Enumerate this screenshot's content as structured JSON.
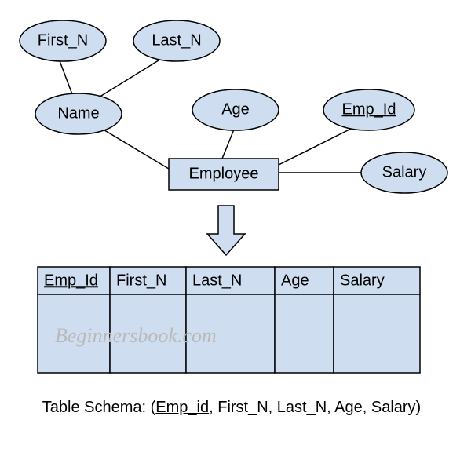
{
  "er": {
    "entity": "Employee",
    "attrs": {
      "first_n": "First_N",
      "last_n": "Last_N",
      "name": "Name",
      "age": "Age",
      "emp_id": "Emp_Id",
      "salary": "Salary"
    }
  },
  "table": {
    "headers": {
      "emp_id": "Emp_Id",
      "first_n": "First_N",
      "last_n": "Last_N",
      "age": "Age",
      "salary": "Salary"
    }
  },
  "schema": {
    "prefix": "Table Schema: (",
    "key": "Emp_id",
    "rest": ", First_N, Last_N, Age, Salary)"
  },
  "watermark": "Beginnersbook.com"
}
